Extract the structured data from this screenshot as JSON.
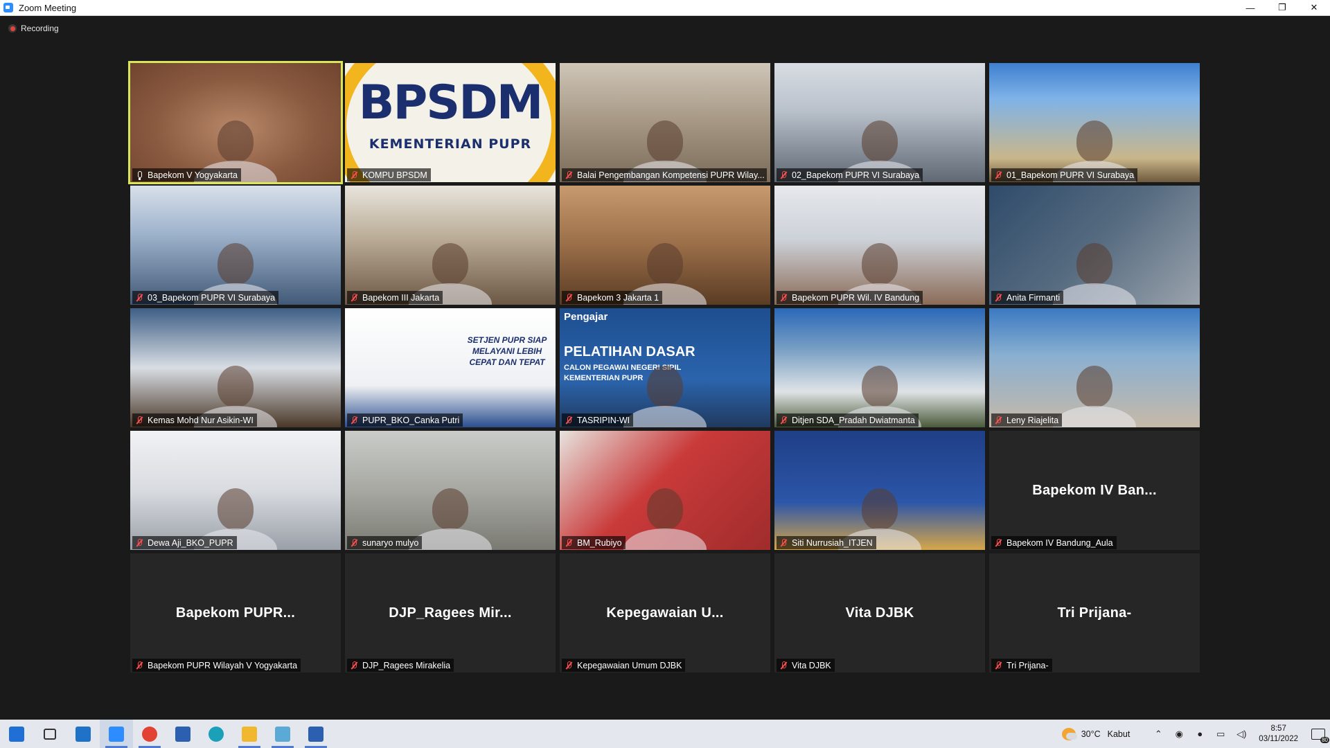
{
  "window": {
    "title": "Zoom Meeting",
    "minimize": "—",
    "restore": "❐",
    "close": "✕"
  },
  "meeting": {
    "recording_label": "Recording",
    "accent_active_speaker": "#d9e65c",
    "muted_color": "#ff4d4d",
    "participants": [
      {
        "name": "Bapekom V Yogyakarta",
        "mic": "live",
        "active": true,
        "video": true
      },
      {
        "name": "KOMPU BPSDM",
        "mic": "muted",
        "video": true,
        "logo_line1": "BPSDM",
        "logo_line2": "KEMENTERIAN PUPR"
      },
      {
        "name": "Balai Pengembangan Kompetensi PUPR Wilay...",
        "mic": "muted",
        "video": true
      },
      {
        "name": "02_Bapekom PUPR VI Surabaya",
        "mic": "muted",
        "video": true
      },
      {
        "name": "01_Bapekom PUPR VI Surabaya",
        "mic": "muted",
        "video": true
      },
      {
        "name": "03_Bapekom PUPR VI Surabaya",
        "mic": "muted",
        "video": true
      },
      {
        "name": "Bapekom III Jakarta",
        "mic": "muted",
        "video": true
      },
      {
        "name": "Bapekom 3 Jakarta 1",
        "mic": "muted",
        "video": true
      },
      {
        "name": "Bapekom PUPR Wil. IV Bandung",
        "mic": "muted",
        "video": true
      },
      {
        "name": "Anita Firmanti",
        "mic": "muted",
        "video": true
      },
      {
        "name": "Kemas Mohd Nur Asikin-WI",
        "mic": "muted",
        "video": true
      },
      {
        "name": "PUPR_BKO_Canka Putri",
        "mic": "muted",
        "video": true,
        "slide_text": "SETJEN PUPR SIAP MELAYANI LEBIH CEPAT DAN TEPAT"
      },
      {
        "name": "TASRIPIN-WI",
        "mic": "muted",
        "video": true,
        "banner_tag": "Pengajar",
        "banner_title": "PELATIHAN DASAR",
        "banner_sub": "CALON PEGAWAI NEGERI SIPIL",
        "banner_sub2": "KEMENTERIAN PUPR"
      },
      {
        "name": "Ditjen SDA_Pradah Dwiatmanta",
        "mic": "muted",
        "video": true
      },
      {
        "name": "Leny Riajelita",
        "mic": "muted",
        "video": true
      },
      {
        "name": "Dewa Aji_BKO_PUPR",
        "mic": "muted",
        "video": true
      },
      {
        "name": "sunaryo mulyo",
        "mic": "muted",
        "video": true
      },
      {
        "name": "BM_Rubiyo",
        "mic": "muted",
        "video": true
      },
      {
        "name": "Siti Nurrusiah_ITJEN",
        "mic": "muted",
        "video": true
      },
      {
        "name": "Bapekom IV Bandung_Aula",
        "mic": "muted",
        "video": false,
        "display": "Bapekom IV Ban..."
      },
      {
        "name": "Bapekom PUPR Wilayah V Yogyakarta",
        "mic": "muted",
        "video": false,
        "display": "Bapekom PUPR..."
      },
      {
        "name": "DJP_Ragees Mirakelia",
        "mic": "muted",
        "video": false,
        "display": "DJP_Ragees Mir..."
      },
      {
        "name": "Kepegawaian Umum DJBK",
        "mic": "muted",
        "video": false,
        "display": "Kepegawaian U..."
      },
      {
        "name": "Vita DJBK",
        "mic": "muted",
        "video": false,
        "display": "Vita DJBK"
      },
      {
        "name": "Tri Prijana-",
        "mic": "muted",
        "video": false,
        "display": "Tri Prijana-"
      }
    ]
  },
  "taskbar": {
    "apps": [
      {
        "icon": "windows-start-icon",
        "running": false
      },
      {
        "icon": "task-view-icon",
        "running": false
      },
      {
        "icon": "mail-icon",
        "running": false
      },
      {
        "icon": "zoom-icon",
        "running": true,
        "focused": true
      },
      {
        "icon": "chrome-icon",
        "running": true
      },
      {
        "icon": "store-icon",
        "running": false
      },
      {
        "icon": "edge-icon",
        "running": false
      },
      {
        "icon": "file-explorer-icon",
        "running": true
      },
      {
        "icon": "app-icon",
        "running": true
      },
      {
        "icon": "word-icon",
        "running": true
      }
    ],
    "weather_temp": "30°C",
    "weather_desc": "Kabut",
    "time": "8:57",
    "date": "03/11/2022",
    "notification_count": "80"
  }
}
